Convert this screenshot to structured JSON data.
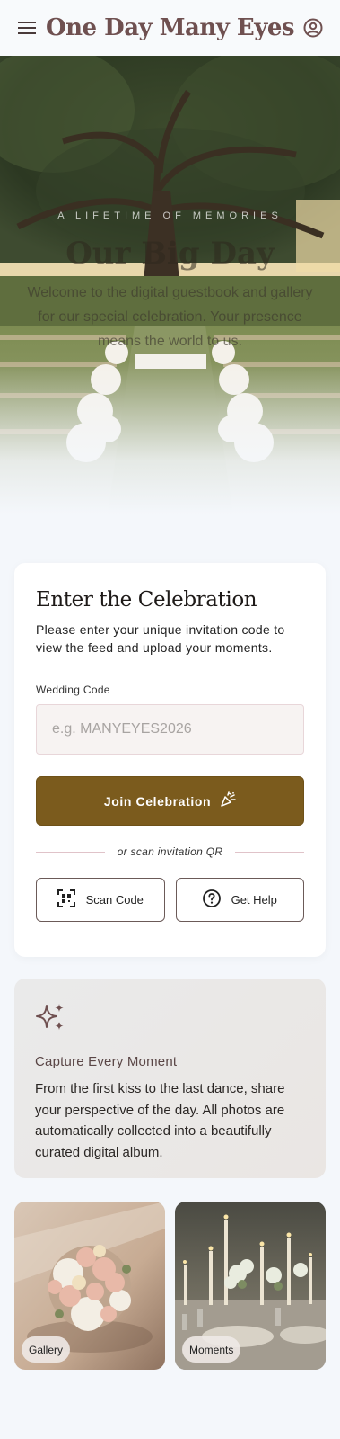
{
  "header": {
    "title": "One Day Many Eyes",
    "menu_icon": "menu-icon",
    "account_icon": "account-circle-icon"
  },
  "hero": {
    "kicker": "A LIFETIME OF MEMORIES",
    "title": "Our Big Day",
    "subtitle": "Welcome to the digital guestbook and gallery for our special celebration. Your presence means the world to us."
  },
  "join": {
    "title": "Enter the Celebration",
    "description": "Please enter your unique invitation code to view the feed and upload your moments.",
    "field_label": "Wedding Code",
    "field_value": "",
    "field_placeholder": "e.g. MANYEYES2026",
    "button_label": "Join Celebration",
    "button_icon": "party-popper-icon",
    "divider_text": "or scan invitation QR",
    "scan_label": "Scan Code",
    "scan_icon": "qr-scan-icon",
    "help_label": "Get Help",
    "help_icon": "help-circle-icon",
    "colors": {
      "primary": "#7b5b1d",
      "accent": "#6f5050"
    }
  },
  "feature": {
    "icon": "sparkles-icon",
    "title": "Capture Every Moment",
    "text": "From the first kiss to the last dance, share your perspective of the day. All photos are automatically collected into a beautifully curated digital album."
  },
  "tiles": [
    {
      "label": "Gallery"
    },
    {
      "label": "Moments"
    }
  ]
}
